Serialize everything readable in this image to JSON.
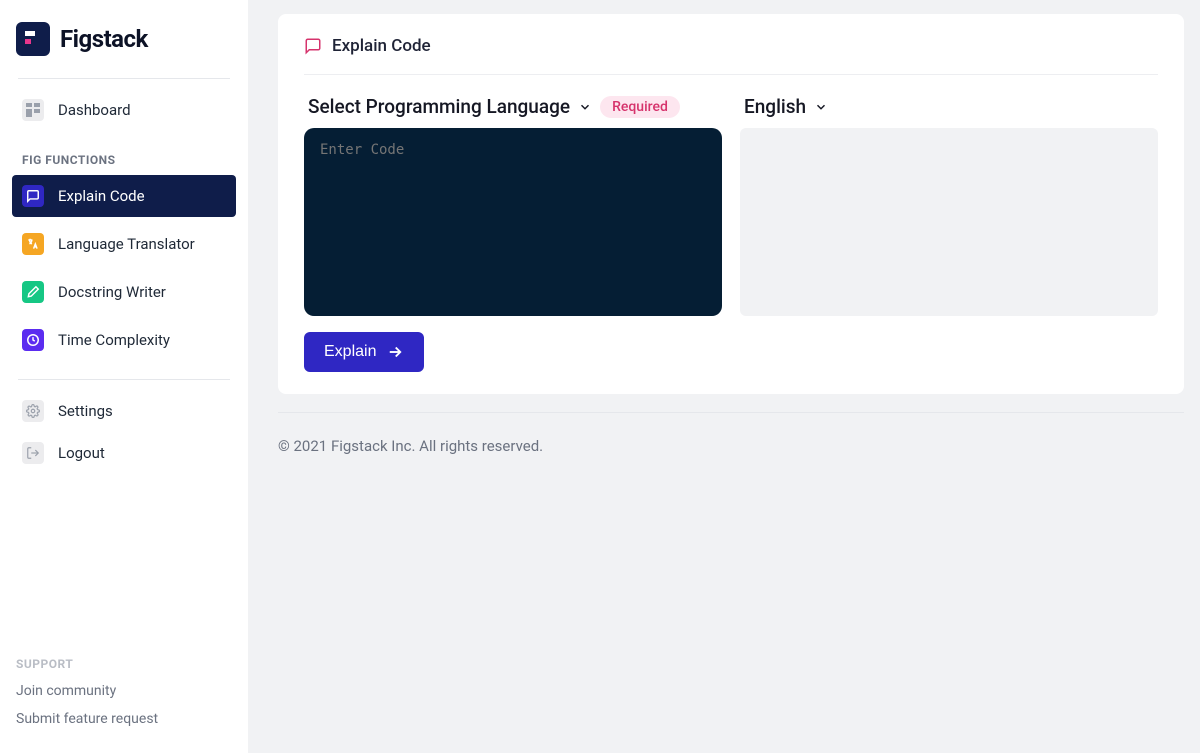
{
  "brand": {
    "name": "Figstack"
  },
  "sidebar": {
    "dashboard": "Dashboard",
    "section_label": "FIG FUNCTIONS",
    "items": [
      {
        "label": "Explain Code"
      },
      {
        "label": "Language Translator"
      },
      {
        "label": "Docstring Writer"
      },
      {
        "label": "Time Complexity"
      }
    ],
    "settings": "Settings",
    "logout": "Logout"
  },
  "support": {
    "label": "SUPPORT",
    "join": "Join community",
    "submit": "Submit feature request"
  },
  "main": {
    "title": "Explain Code",
    "language_selector": "Select Programming Language",
    "required_badge": "Required",
    "output_language": "English",
    "code_placeholder": "Enter Code",
    "explain_button": "Explain"
  },
  "footer": "© 2021 Figstack Inc. All rights reserved."
}
